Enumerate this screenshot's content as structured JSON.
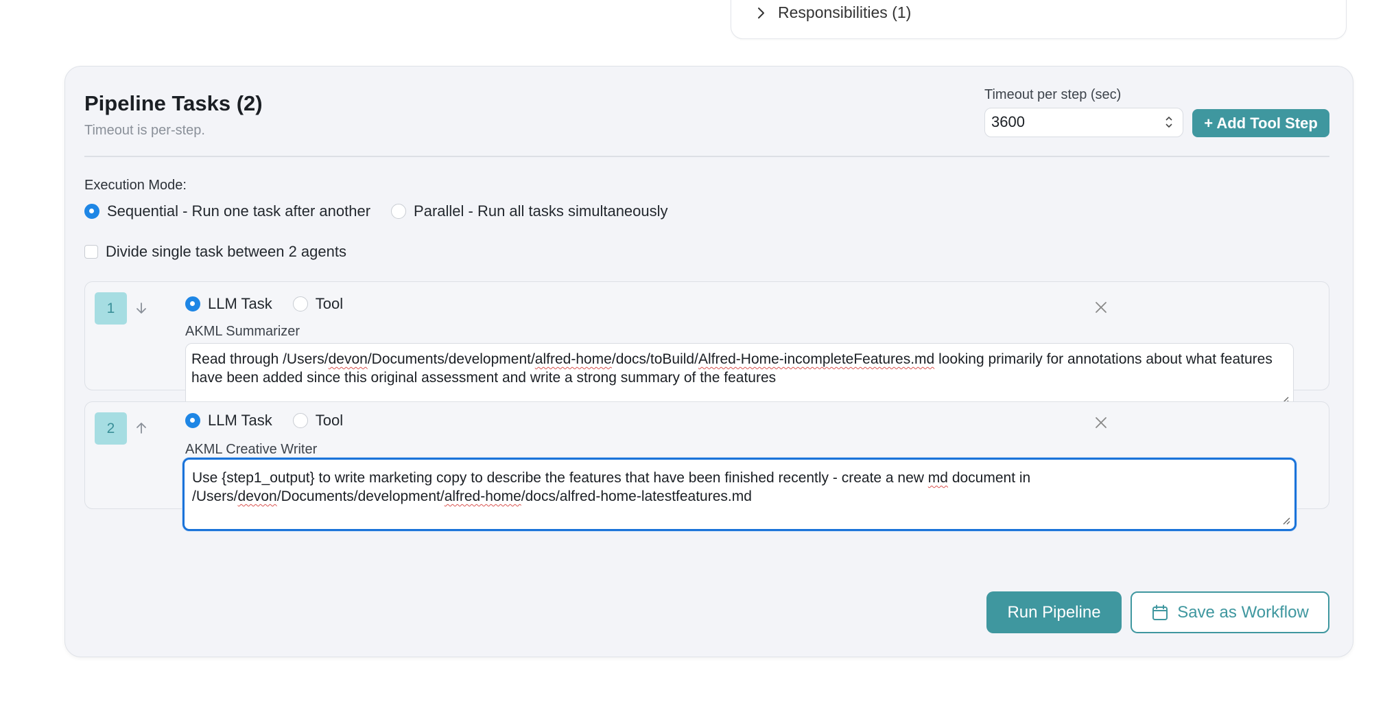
{
  "top_card": {
    "responsibilities_label": "Responsibilities (1)"
  },
  "panel": {
    "title": "Pipeline Tasks (2)",
    "subtitle": "Timeout is per-step.",
    "timeout_label": "Timeout per step (sec)",
    "timeout_value": "3600",
    "add_tool_step_label": "+ Add Tool Step",
    "execution_mode_label": "Execution Mode:",
    "execution_modes": [
      {
        "label": "Sequential - Run one task after another",
        "selected": true
      },
      {
        "label": "Parallel - Run all tasks simultaneously",
        "selected": false
      }
    ],
    "divide_label": "Divide single task between 2 agents",
    "divide_checked": false
  },
  "tasks": [
    {
      "number": "1",
      "type_options": [
        "LLM Task",
        "Tool"
      ],
      "selected_type": "LLM Task",
      "agent_name": "AKML Summarizer",
      "prompt_parts": [
        "Read through /Users/",
        "devon",
        "/Documents/development/",
        "alfred-home",
        "/docs/toBuild/",
        "Alfred-Home-incompleteFeatures.md",
        " looking primarily for annotations about what features have been added since this original assessment and write a strong summary of the features"
      ]
    },
    {
      "number": "2",
      "type_options": [
        "LLM Task",
        "Tool"
      ],
      "selected_type": "LLM Task",
      "agent_name": "AKML Creative Writer",
      "prompt_parts": [
        "Use {step1_output} to write marketing copy to describe the features that have been finished recently - create a new ",
        "md",
        " document in /Users/",
        "devon",
        "/Documents/development/",
        "alfred-home",
        "/docs/alfred-home-latestfeatures.md"
      ]
    }
  ],
  "footer": {
    "run_label": "Run Pipeline",
    "save_label": "Save as Workflow"
  },
  "colors": {
    "accent": "#3f979f",
    "radio_selected": "#1e86e5",
    "focus_border": "#1a73d9",
    "step_badge_bg": "#a6dde2"
  },
  "icons": {
    "expand": "chevron-right-icon",
    "move_down": "arrow-down-icon",
    "move_up": "arrow-up-icon",
    "remove": "close-icon",
    "save": "calendar-icon"
  }
}
